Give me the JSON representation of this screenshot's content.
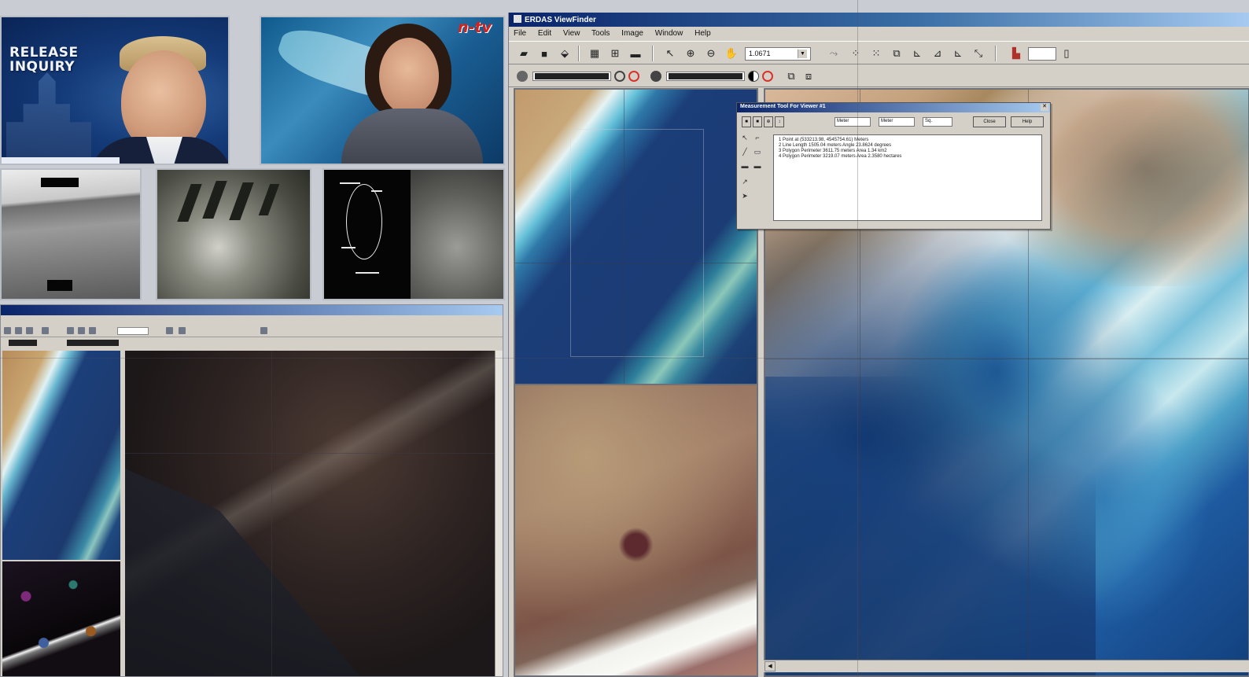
{
  "news_left": {
    "title_line1": "RELEASE",
    "title_line2": "INQUIRY"
  },
  "news_right": {
    "channel_logo": "n-tv"
  },
  "erdas": {
    "title": "ERDAS ViewFinder",
    "menu": [
      "File",
      "Edit",
      "View",
      "Tools",
      "Image",
      "Window",
      "Help"
    ],
    "zoom_value": "1.0671",
    "dialog": {
      "title": "Measurement Tool For Viewer #1",
      "units": [
        "Meter",
        "Meter",
        "Sq."
      ],
      "close_label": "Close",
      "help_label": "Help",
      "measurements": [
        "1  Point at (533213.98, 4545754.61) Meters",
        "2  Line Length 1505.04 meters  Angle 23.8624 degrees",
        "3  Polygon Perimeter 3611.75 meters  Area 1.34 km2",
        "4  Polygon Perimeter 3219.07 meters  Area 2.3580 hectares"
      ]
    }
  },
  "colors": {
    "titlebar": "#0a246a",
    "chrome": "#d4d0c8",
    "ocean": "#1b3d78"
  },
  "icons": [
    "open-icon",
    "save-icon",
    "print-icon",
    "grid-icon",
    "measure-icon",
    "select-icon",
    "zoom-in-icon",
    "zoom-out-icon",
    "pan-icon",
    "contrast-icon",
    "prohibit-icon"
  ]
}
